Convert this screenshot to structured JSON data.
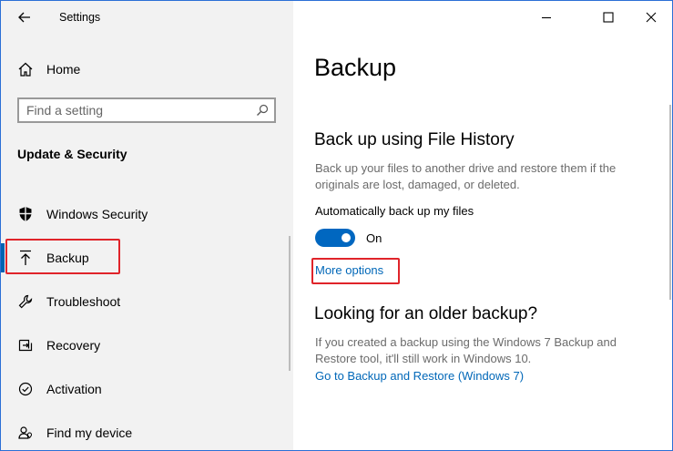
{
  "window": {
    "title": "Settings"
  },
  "sidebar": {
    "home_label": "Home",
    "search_placeholder": "Find a setting",
    "section_title": "Update & Security",
    "items": [
      {
        "label": "Windows Security",
        "icon": "shield-icon"
      },
      {
        "label": "Backup",
        "icon": "backup-arrow-icon",
        "selected": true
      },
      {
        "label": "Troubleshoot",
        "icon": "wrench-icon"
      },
      {
        "label": "Recovery",
        "icon": "recovery-icon"
      },
      {
        "label": "Activation",
        "icon": "activation-icon"
      },
      {
        "label": "Find my device",
        "icon": "person-location-icon"
      }
    ]
  },
  "main": {
    "title": "Backup",
    "file_history": {
      "heading": "Back up using File History",
      "description": "Back up your files to another drive and restore them if the originals are lost, damaged, or deleted.",
      "toggle_label": "Automatically back up my files",
      "toggle_state": "On",
      "more_options": "More options"
    },
    "older_backup": {
      "heading": "Looking for an older backup?",
      "description": "If you created a backup using the Windows 7 Backup and Restore tool, it'll still work in Windows 10.",
      "link": "Go to Backup and Restore (Windows 7)"
    }
  },
  "colors": {
    "accent": "#0067c0",
    "link": "#0067b8",
    "highlight": "#e0242a",
    "sidebar_bg": "#f2f2f2"
  }
}
